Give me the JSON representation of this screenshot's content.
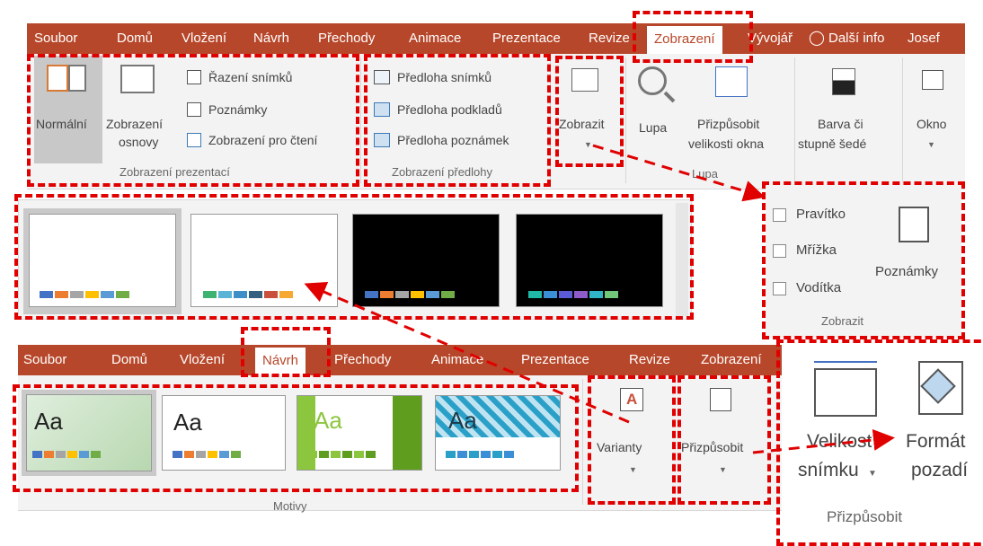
{
  "top_ribbon": {
    "tabs": [
      "Soubor",
      "Domů",
      "Vložení",
      "Návrh",
      "Přechody",
      "Animace",
      "Prezentace",
      "Revize",
      "Zobrazení",
      "Vývojář",
      "Další info",
      "Josef"
    ],
    "active_tab": "Zobrazení",
    "tell_me_icon": "lightbulb-icon",
    "presentation_views": {
      "normal": "Normální",
      "outline_line1": "Zobrazení",
      "outline_line2": "osnovy",
      "slide_sorter": "Řazení snímků",
      "notes_page": "Poznámky",
      "reading_view": "Zobrazení pro čtení",
      "group_label": "Zobrazení prezentací"
    },
    "master_views": {
      "slide_master": "Předloha snímků",
      "handout_master": "Předloha podkladů",
      "notes_master": "Předloha poznámek",
      "group_label": "Zobrazení předlohy"
    },
    "show": {
      "label": "Zobrazit"
    },
    "zoom": {
      "zoom": "Lupa",
      "fit_line1": "Přizpůsobit",
      "fit_line2": "velikosti okna",
      "group_label": "Lupa"
    },
    "color": {
      "line1": "Barva či",
      "line2": "stupně šedé"
    },
    "window": {
      "label": "Okno"
    }
  },
  "show_panel": {
    "ruler": "Pravítko",
    "gridlines": "Mřížka",
    "guides": "Vodítka",
    "notes": "Poznámky",
    "group_label": "Zobrazit"
  },
  "variants_gallery": {
    "swatch_colors": [
      [
        "#4472c4",
        "#ed7d31",
        "#a5a5a5",
        "#ffc000",
        "#5b9bd5",
        "#70ad47"
      ],
      [
        "#3cb371",
        "#5ab4d6",
        "#3e8fc8",
        "#35607f",
        "#c8503c",
        "#f7a830"
      ],
      [
        "#4472c4",
        "#ed7d31",
        "#a5a5a5",
        "#ffc000",
        "#5b9bd5",
        "#70ad47"
      ],
      [
        "#1fb8a7",
        "#3a8fd6",
        "#5b5bd6",
        "#8f5bc8",
        "#2fb4c8",
        "#72c87a"
      ]
    ]
  },
  "design_ribbon": {
    "tabs": [
      "Soubor",
      "Domů",
      "Vložení",
      "Návrh",
      "Přechody",
      "Animace",
      "Prezentace",
      "Revize",
      "Zobrazení"
    ],
    "active_tab": "Návrh",
    "themes": [
      "Aa",
      "Aa",
      "Aa",
      "Aa"
    ],
    "themes_group_label": "Motivy",
    "variants": "Varianty",
    "customize": "Přizpůsobit"
  },
  "customize_panel": {
    "slide_size_line1": "Velikost",
    "slide_size_line2": "snímku",
    "format_bg_line1": "Formát",
    "format_bg_line2": "pozadí",
    "group_label": "Přizpůsobit"
  },
  "colors": {
    "ribbon_red": "#b7472a",
    "annotation_red": "#e00000"
  }
}
